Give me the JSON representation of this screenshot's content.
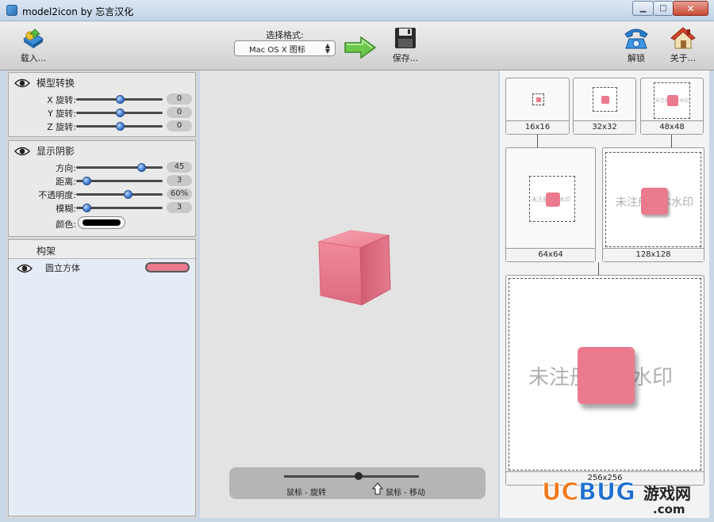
{
  "window": {
    "title": "model2icon by 忘言汉化"
  },
  "toolbar": {
    "import_label": "载入...",
    "format_label": "选择格式:",
    "format_value": "Mac OS X 图标",
    "save_label": "保存...",
    "lock_label": "解锁",
    "about_label": "关于..."
  },
  "rotate": {
    "title": "模型转换",
    "rows": [
      {
        "label": "X 旋转:",
        "value": "0",
        "level": 0.5
      },
      {
        "label": "Y 旋转:",
        "value": "0",
        "level": 0.5
      },
      {
        "label": "Z 旋转:",
        "value": "0",
        "level": 0.5
      }
    ]
  },
  "shadow": {
    "title": "显示阴影",
    "rows": [
      {
        "label": "方向:",
        "value": "45",
        "level": 0.75
      },
      {
        "label": "距离:",
        "value": "3",
        "level": 0.12
      },
      {
        "label": "不透明度:",
        "value": "60%",
        "level": 0.6
      },
      {
        "label": "模糊:",
        "value": "3",
        "level": 0.12
      }
    ],
    "color_label": "颜色:",
    "color_value": "#000000"
  },
  "tree": {
    "header": "构架",
    "item_label": "圆立方体",
    "item_color": "#ec7a8e"
  },
  "viewport": {
    "rotate_hint": "鼠标 - 旋转",
    "move_hint": "鼠标 - 移动"
  },
  "previews": {
    "p16": "16x16",
    "p32": "32x32",
    "p48": "48x48",
    "p64": "64x64",
    "p128": "128x128",
    "p256": "256x256",
    "watermark": "未注册版本水印"
  },
  "logo": {
    "brand": "UCBUG",
    "cn": "游戏网",
    "domain": ".com"
  },
  "colors": {
    "cube": "#ec7a8e",
    "accent_blue": "#3d78d0",
    "logo_orange": "#f07a1d",
    "logo_blue": "#1e6fd0"
  }
}
